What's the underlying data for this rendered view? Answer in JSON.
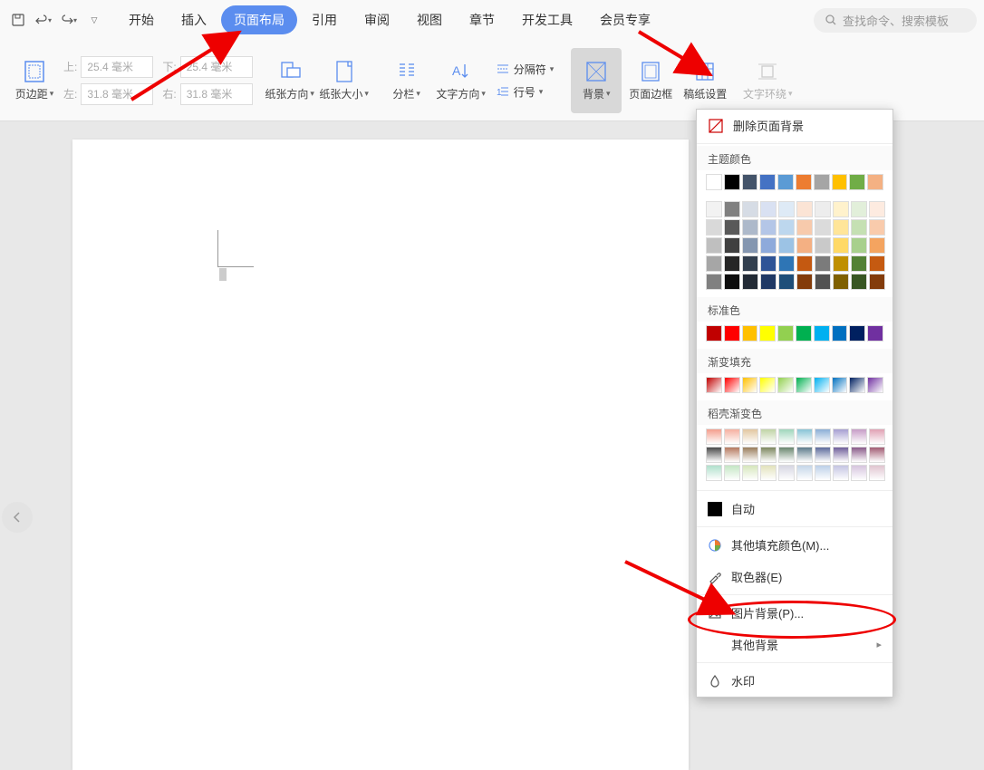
{
  "menubar": {
    "items": [
      "开始",
      "插入",
      "页面布局",
      "引用",
      "审阅",
      "视图",
      "章节",
      "开发工具",
      "会员专享"
    ],
    "active_index": 2,
    "search_placeholder": "查找命令、搜索模板"
  },
  "ribbon": {
    "margins_btn": "页边距",
    "margin_labels": {
      "top": "上:",
      "bottom": "下:",
      "left": "左:",
      "right": "右:"
    },
    "margin_values": {
      "top": "25.4 毫米",
      "bottom": "25.4 毫米",
      "left": "31.8 毫米",
      "right": "31.8 毫米"
    },
    "paper_dir": "纸张方向",
    "paper_size": "纸张大小",
    "columns": "分栏",
    "text_dir": "文字方向",
    "line_no": "行号",
    "separator": "分隔符",
    "background": "背景",
    "border": "页面边框",
    "manuscript": "稿纸设置",
    "wrap": "文字环绕"
  },
  "dropdown": {
    "remove_bg": "删除页面背景",
    "theme_colors_label": "主题颜色",
    "theme_colors_top": [
      "#ffffff",
      "#000000",
      "#44546a",
      "#4472c4",
      "#5b9bd5",
      "#ed7d31",
      "#a5a5a5",
      "#ffc000",
      "#70ad47",
      "#f4b183"
    ],
    "theme_colors_shades": [
      [
        "#f2f2f2",
        "#808080",
        "#d6dce5",
        "#d9e1f2",
        "#deeaf6",
        "#fbe4d5",
        "#ededed",
        "#fff2cc",
        "#e2efda",
        "#fdebe0"
      ],
      [
        "#d9d9d9",
        "#595959",
        "#adb9ca",
        "#b4c6e7",
        "#bdd7ee",
        "#f7caac",
        "#dbdbdb",
        "#ffe599",
        "#c5e0b3",
        "#f9cbac"
      ],
      [
        "#bfbfbf",
        "#404040",
        "#8496b0",
        "#8eaadb",
        "#9cc3e5",
        "#f4b083",
        "#c9c9c9",
        "#ffd966",
        "#a8d08d",
        "#f4a460"
      ],
      [
        "#a6a6a6",
        "#262626",
        "#323f4f",
        "#2f5496",
        "#2e75b5",
        "#c45911",
        "#7b7b7b",
        "#bf8f00",
        "#538135",
        "#c55a11"
      ],
      [
        "#808080",
        "#0d0d0d",
        "#222a35",
        "#1f3864",
        "#1e4e79",
        "#833c0b",
        "#525252",
        "#7f6000",
        "#385623",
        "#833c0c"
      ]
    ],
    "standard_colors_label": "标准色",
    "standard_colors": [
      "#c00000",
      "#ff0000",
      "#ffc000",
      "#ffff00",
      "#92d050",
      "#00b050",
      "#00b0f0",
      "#0070c0",
      "#002060",
      "#7030a0"
    ],
    "gradient_label": "渐变填充",
    "gradient_colors": [
      "#c00000",
      "#ff0000",
      "#ffc000",
      "#ffff00",
      "#92d050",
      "#00b050",
      "#00b0f0",
      "#0070c0",
      "#002060",
      "#7030a0"
    ],
    "doker_label": "稻壳渐变色",
    "doker_gradients": [
      [
        "#f49e8d",
        "#f5b0a0",
        "#e2c7a0",
        "#c0d4a6",
        "#9fd6bc",
        "#88c4d6",
        "#8baed6",
        "#a69ed1",
        "#c79dc7",
        "#e0a1b4"
      ],
      [
        "#4a4a4a",
        "#b57a60",
        "#9a7e5d",
        "#7e8860",
        "#6a876f",
        "#5e7c8c",
        "#5e6c9d",
        "#6f5f9a",
        "#8a5c8a",
        "#a25d74"
      ],
      [
        "#b0e0cc",
        "#c4e6c4",
        "#d6e6bc",
        "#e2e2bc",
        "#d6d6e2",
        "#c4d6e8",
        "#bcd0e8",
        "#c4c4e2",
        "#d6c4de",
        "#e0c4d0"
      ]
    ],
    "auto_label": "自动",
    "more_colors": "其他填充颜色(M)...",
    "eyedropper": "取色器(E)",
    "pic_bg": "图片背景(P)...",
    "other_bg": "其他背景",
    "watermark": "水印"
  }
}
